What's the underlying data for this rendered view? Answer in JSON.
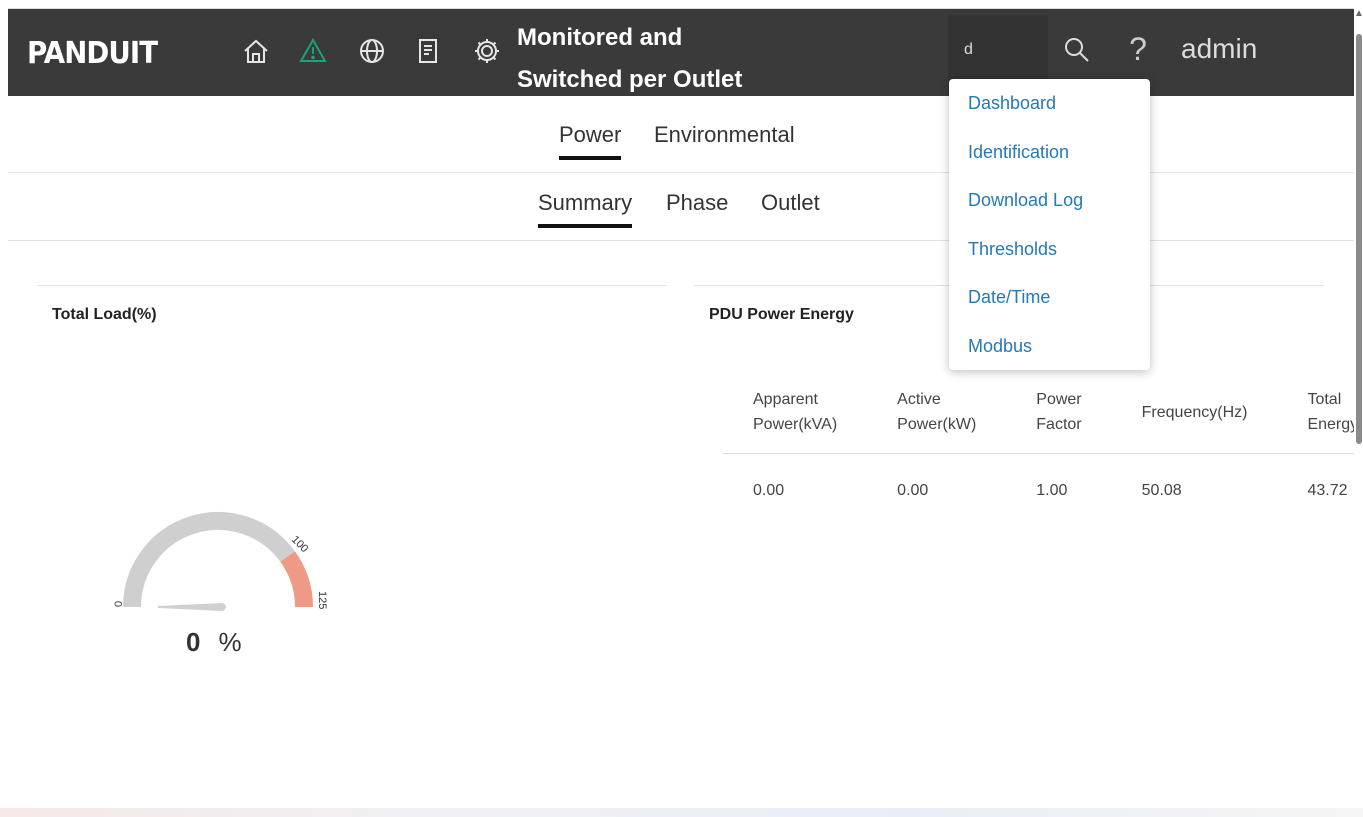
{
  "header": {
    "logo": "PANDUIT",
    "title_line1": "Monitored and",
    "title_line2": "Switched per Outlet",
    "search_value": "d",
    "help": "?",
    "user": "admin"
  },
  "nav_icons": [
    "home-icon",
    "alert-icon",
    "globe-icon",
    "log-icon",
    "gear-icon"
  ],
  "colors": {
    "header_bg": "#3a3a3a",
    "alert": "#1aa37a",
    "link": "#2479b6",
    "gauge_track": "#cfcfcf",
    "gauge_warning": "#ee9a84"
  },
  "tabs_primary": [
    {
      "label": "Power",
      "active": true
    },
    {
      "label": "Environmental",
      "active": false
    }
  ],
  "tabs_secondary": [
    {
      "label": "Summary",
      "active": true
    },
    {
      "label": "Phase",
      "active": false
    },
    {
      "label": "Outlet",
      "active": false
    }
  ],
  "total_load": {
    "title": "Total Load(%)",
    "value": "0",
    "unit": "%",
    "scale_min": "0",
    "scale_threshold": "100",
    "scale_max": "125",
    "level": 0
  },
  "energy": {
    "title": "PDU Power Energy",
    "headers": [
      [
        "Apparent",
        "Power(kVA)"
      ],
      [
        "Active",
        "Power(kW)"
      ],
      [
        "Power",
        "Factor"
      ],
      [
        "Frequency(Hz)",
        ""
      ],
      [
        "Total",
        "Energy(kWh)"
      ]
    ],
    "values": [
      "0.00",
      "0.00",
      "1.00",
      "50.08",
      "43.72"
    ]
  },
  "dropdown": [
    "Dashboard",
    "Identification",
    "Download Log",
    "Thresholds",
    "Date/Time",
    "Modbus"
  ]
}
